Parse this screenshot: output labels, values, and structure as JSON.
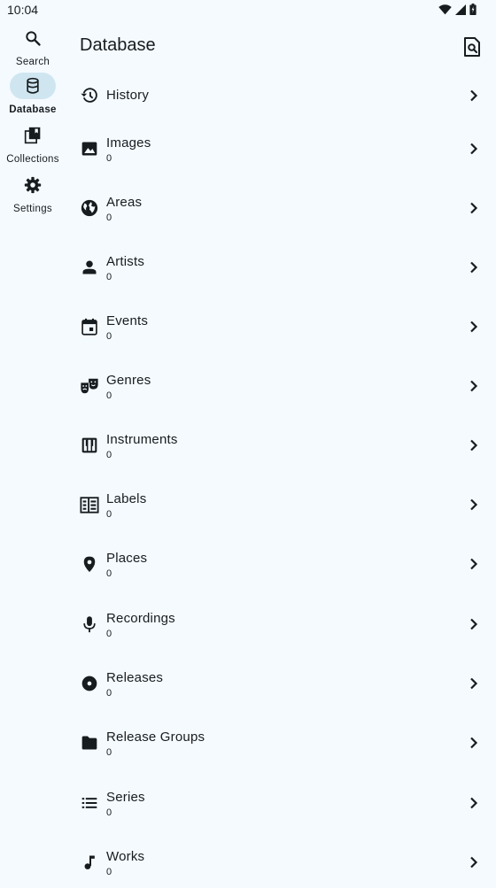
{
  "status": {
    "time": "10:04"
  },
  "rail": {
    "items": [
      {
        "label": "Search",
        "icon": "search-icon"
      },
      {
        "label": "Database",
        "icon": "database-icon",
        "active": true
      },
      {
        "label": "Collections",
        "icon": "collections-icon"
      },
      {
        "label": "Settings",
        "icon": "gear-icon"
      }
    ]
  },
  "header": {
    "title": "Database",
    "action_icon": "search-database-icon"
  },
  "list": {
    "items": [
      {
        "label": "History",
        "icon": "history-icon"
      },
      {
        "label": "Images",
        "count": "0",
        "icon": "image-icon"
      },
      {
        "label": "Areas",
        "count": "0",
        "icon": "globe-icon"
      },
      {
        "label": "Artists",
        "count": "0",
        "icon": "person-icon"
      },
      {
        "label": "Events",
        "count": "0",
        "icon": "calendar-icon"
      },
      {
        "label": "Genres",
        "count": "0",
        "icon": "theater-masks-icon"
      },
      {
        "label": "Instruments",
        "count": "0",
        "icon": "piano-icon"
      },
      {
        "label": "Labels",
        "count": "0",
        "icon": "label-building-icon"
      },
      {
        "label": "Places",
        "count": "0",
        "icon": "place-pin-icon"
      },
      {
        "label": "Recordings",
        "count": "0",
        "icon": "microphone-icon"
      },
      {
        "label": "Releases",
        "count": "0",
        "icon": "album-icon"
      },
      {
        "label": "Release Groups",
        "count": "0",
        "icon": "folder-icon"
      },
      {
        "label": "Series",
        "count": "0",
        "icon": "list-icon"
      },
      {
        "label": "Works",
        "count": "0",
        "icon": "music-note-icon"
      }
    ]
  },
  "colors": {
    "background": "#f4fafe",
    "active_pill": "#cfe6f1",
    "text": "#171c1f"
  }
}
